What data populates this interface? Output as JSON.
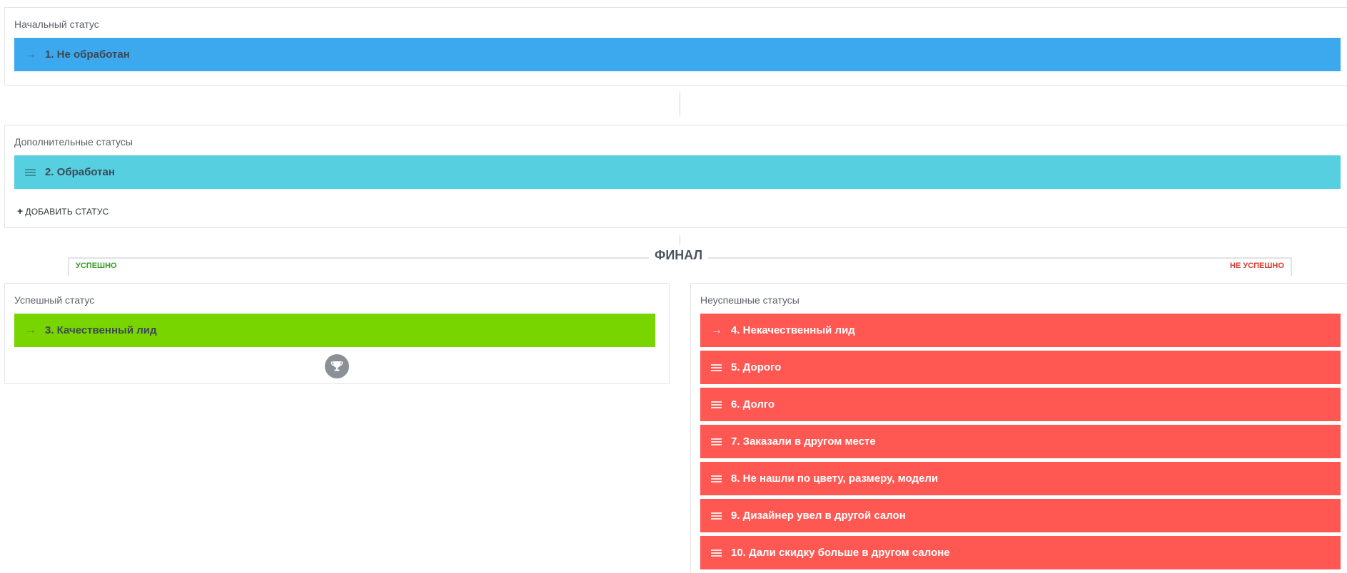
{
  "initial": {
    "title": "Начальный статус",
    "status": {
      "label": "1. Не обработан",
      "icon": "arrow-right-icon",
      "color": "#3ca9ee"
    }
  },
  "additional": {
    "title": "Дополнительные статусы",
    "status": {
      "label": "2. Обработан",
      "icon": "drag-handle-icon",
      "color": "#56cfe1"
    },
    "add_label": "ДОБАВИТЬ СТАТУС"
  },
  "final": {
    "title": "ФИНАЛ",
    "success_label": "УСПЕШНО",
    "fail_label": "НЕ УСПЕШНО"
  },
  "success": {
    "title": "Успешный статус",
    "status": {
      "label": "3. Качественный лид",
      "icon": "arrow-right-icon",
      "color": "#78d500"
    },
    "badge_icon": "trophy-icon"
  },
  "failure": {
    "title": "Неуспешные статусы",
    "color": "#ff5752",
    "statuses": [
      {
        "label": "4. Некачественный лид",
        "icon": "arrow-right-icon"
      },
      {
        "label": "5. Дорого",
        "icon": "drag-handle-icon"
      },
      {
        "label": "6. Долго",
        "icon": "drag-handle-icon"
      },
      {
        "label": "7. Заказали в другом месте",
        "icon": "drag-handle-icon"
      },
      {
        "label": "8. Не нашли по цвету, размеру, модели",
        "icon": "drag-handle-icon"
      },
      {
        "label": "9. Дизайнер увел в другой салон",
        "icon": "drag-handle-icon"
      },
      {
        "label": "10. Дали скидку больше в другом салоне",
        "icon": "drag-handle-icon"
      }
    ]
  }
}
